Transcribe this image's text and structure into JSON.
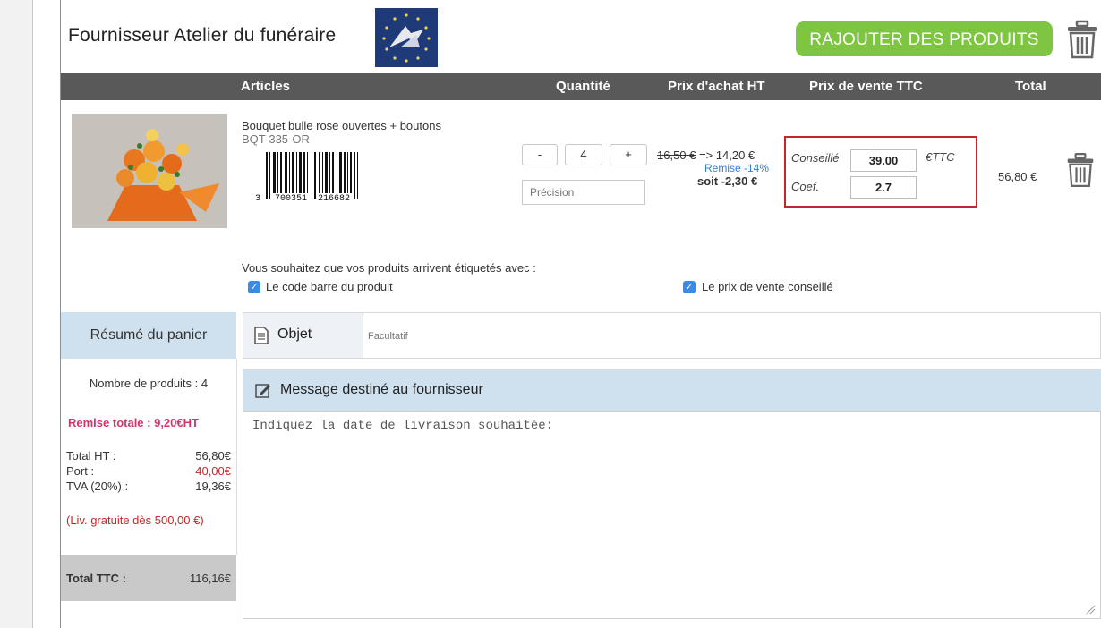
{
  "header": {
    "supplier": "Fournisseur Atelier du funéraire",
    "add_button": "RAJOUTER DES PRODUITS"
  },
  "columns": {
    "articles": "Articles",
    "quantite": "Quantité",
    "prix_achat": "Prix d'achat HT",
    "prix_vente": "Prix de vente TTC",
    "total": "Total"
  },
  "product": {
    "name": "Bouquet bulle rose ouvertes + boutons",
    "ref": "BQT-335-OR",
    "barcode_left": "3",
    "barcode_mid": "700351",
    "barcode_right": "216682",
    "qty_minus": "-",
    "qty_value": "4",
    "qty_plus": "+",
    "precision_placeholder": "Précision",
    "old_price": "16,50 €",
    "arrow": " => 14,20 €",
    "remise": "Remise -14%",
    "soit": "soit -2,30 €",
    "conseille_label": "Conseillé",
    "conseille_value": "39.00",
    "ettc": "€TTC",
    "coef_label": "Coef.",
    "coef_value": "2.7",
    "total": "56,80 €"
  },
  "labels": {
    "question": "Vous souhaitez que vos produits arrivent étiquetés avec :",
    "opt1": "Le code barre du produit",
    "opt2": "Le prix de vente conseillé"
  },
  "summary": {
    "title": "Résumé du panier",
    "nb_products": "Nombre de produits : 4",
    "remise": "Remise totale : 9,20€HT",
    "total_ht_label": "Total HT :",
    "total_ht": "56,80€",
    "port_label": "Port :",
    "port": "40,00€",
    "tva_label": "TVA (20%) :",
    "tva": "19,36€",
    "livraison": "(Liv. gratuite dès 500,00 €)",
    "total_ttc_label": "Total TTC :",
    "total_ttc": "116,16€"
  },
  "objet": {
    "label": "Objet",
    "placeholder": "Facultatif"
  },
  "message": {
    "label": "Message destiné au fournisseur",
    "text": "Indiquez la date de livraison souhaitée:"
  },
  "colors": {
    "accent_green": "#7ec542",
    "header_bar": "#595959",
    "summary_blue": "#cfe0ee",
    "remise_pink": "#d6336c",
    "port_red": "#c62828",
    "highlight_red": "#c0262e",
    "link_blue": "#2f7fd8"
  }
}
